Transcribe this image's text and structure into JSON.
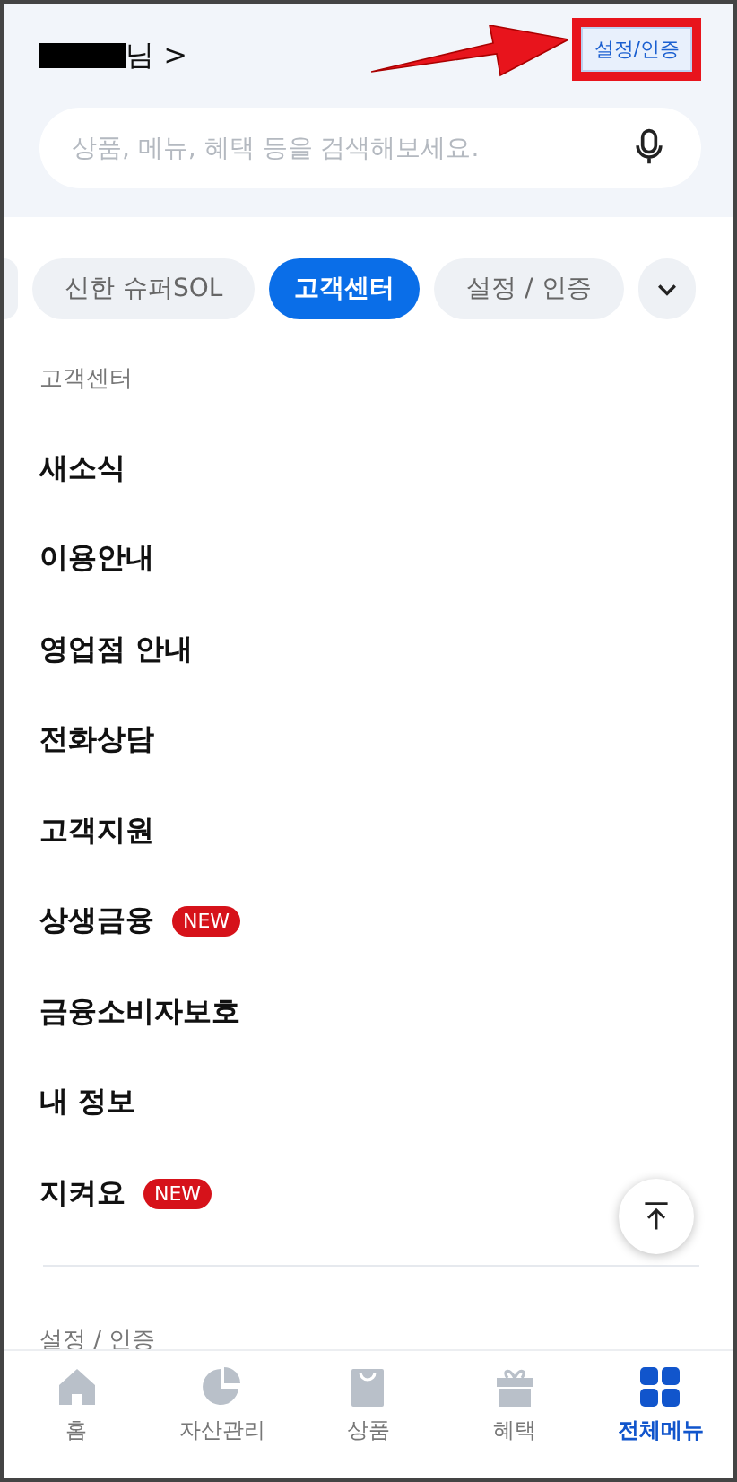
{
  "header": {
    "name_hidden": true,
    "suffix": "님",
    "chevron": ">",
    "settings_button": {
      "label": "설정/인증",
      "highlighted": true
    },
    "pointer_arrow": true
  },
  "search": {
    "placeholder": "상품, 메뉴, 혜택 등을 검색해보세요."
  },
  "chips_cut_left": true,
  "chips": [
    {
      "label": "신한 슈퍼SOL",
      "selected": false
    },
    {
      "label": "고객센터",
      "selected": true
    },
    {
      "label": "설정 / 인증",
      "selected": false
    }
  ],
  "sections": [
    {
      "title": "고객센터",
      "items": [
        {
          "label": "새소식"
        },
        {
          "label": "이용안내"
        },
        {
          "label": "영업점 안내"
        },
        {
          "label": "전화상담"
        },
        {
          "label": "고객지원"
        },
        {
          "label": "상생금융",
          "badge": "NEW"
        },
        {
          "label": "금융소비자보호"
        },
        {
          "label": "내 정보"
        },
        {
          "label": "지켜요",
          "badge": "NEW"
        }
      ]
    },
    {
      "title": "설정 / 인증"
    }
  ],
  "nav": [
    {
      "label": "홈",
      "kind": "home",
      "selected": false
    },
    {
      "label": "자산관리",
      "kind": "chart",
      "selected": false
    },
    {
      "label": "상품",
      "kind": "bag",
      "selected": false
    },
    {
      "label": "혜택",
      "kind": "gift",
      "selected": false
    },
    {
      "label": "전체메뉴",
      "kind": "grid",
      "selected": true
    }
  ]
}
